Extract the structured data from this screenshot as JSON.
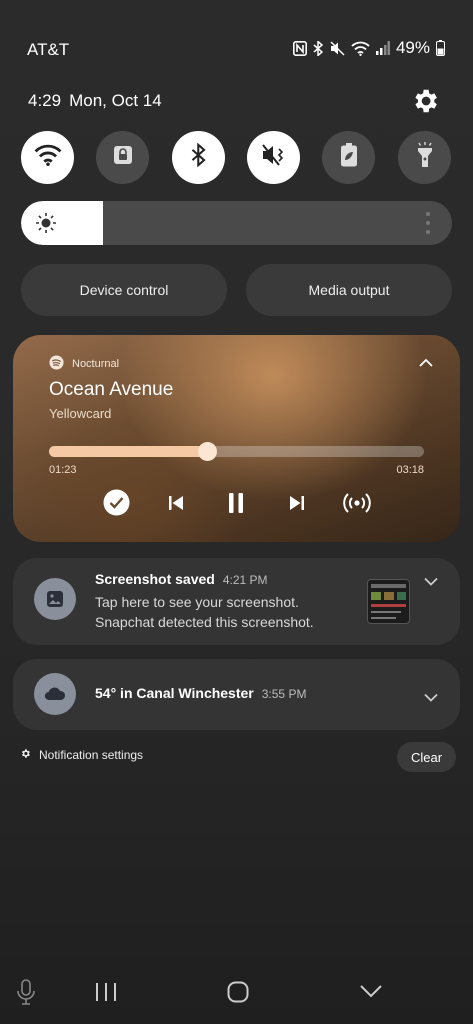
{
  "status_bar": {
    "carrier": "AT&T",
    "battery": "49%",
    "icons": [
      "nfc-icon",
      "bluetooth-icon",
      "mute-icon",
      "wifi-icon",
      "signal-icon",
      "battery-icon"
    ]
  },
  "header": {
    "time": "4:29",
    "date": "Mon, Oct 14"
  },
  "quick_toggles": [
    {
      "name": "wifi",
      "icon": "wifi-icon",
      "on": true
    },
    {
      "name": "rotation-lock",
      "icon": "lock-icon",
      "on": false
    },
    {
      "name": "bluetooth",
      "icon": "bluetooth-icon",
      "on": true
    },
    {
      "name": "sound-mute",
      "icon": "mute-icon",
      "on": true
    },
    {
      "name": "power-saving",
      "icon": "leaf-battery-icon",
      "on": false
    },
    {
      "name": "flashlight",
      "icon": "flashlight-icon",
      "on": false
    }
  ],
  "brightness": {
    "level": 0.19
  },
  "buttons": {
    "device_control": "Device control",
    "media_output": "Media output"
  },
  "media": {
    "app": "Nocturnal",
    "title": "Ocean Avenue",
    "artist": "Yellowcard",
    "position": "01:23",
    "duration": "03:18",
    "progress": 0.42
  },
  "notifications": [
    {
      "title": "Screenshot saved",
      "time": "4:21 PM",
      "line1": "Tap here to see your screenshot.",
      "line2": "Snapchat detected this screenshot."
    },
    {
      "title": "54° in Canal Winchester",
      "time": "3:55 PM"
    }
  ],
  "footer": {
    "settings": "Notification settings",
    "clear": "Clear"
  },
  "colors": {
    "background": "#2a2a2a",
    "toggle_on": "#ffffff",
    "toggle_off": "#4a4a4a",
    "card": "#343434",
    "progress_fill": "#f4c9a3"
  }
}
